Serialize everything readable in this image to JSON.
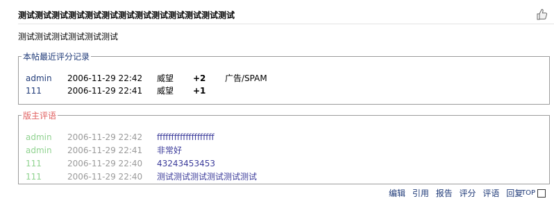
{
  "post": {
    "title": "测试测试测试测试测试测试测试测试测试测试测试测试测试",
    "body": "测试测试测试测试测试测试"
  },
  "rating_log": {
    "legend": "本帖最近评分记录",
    "rows": [
      {
        "user": "admin",
        "time": "2006-11-29 22:42",
        "kind": "威望",
        "score": "+2",
        "reason": "广告/SPAM"
      },
      {
        "user": "111",
        "time": "2006-11-29 22:41",
        "kind": "威望",
        "score": "+1",
        "reason": ""
      }
    ]
  },
  "moderator_comments": {
    "legend": "版主评语",
    "rows": [
      {
        "user": "admin",
        "time": "2006-11-29 22:42",
        "text": "ffffffffffffffffffff"
      },
      {
        "user": "admin",
        "time": "2006-11-29 22:41",
        "text": "非常好"
      },
      {
        "user": "111",
        "time": "2006-11-29 22:40",
        "text": "43243453453"
      },
      {
        "user": "111",
        "time": "2006-11-29 22:40",
        "text": "测试测试测试测试测试测试"
      }
    ]
  },
  "actions": {
    "edit": "编辑",
    "quote": "引用",
    "report": "报告",
    "rate": "评分",
    "comment": "评语",
    "reply": "回复",
    "top": "TOP"
  },
  "icons": {
    "thumb": "thumbs-up-icon",
    "top": "top-icon",
    "select": "checkbox"
  },
  "colors": {
    "user_link": "#1f3a78",
    "comment_user": "#8fd28f",
    "comment_time": "#9a9a9a",
    "comment_text": "#3b3b9a",
    "comment_legend": "#e06060"
  }
}
